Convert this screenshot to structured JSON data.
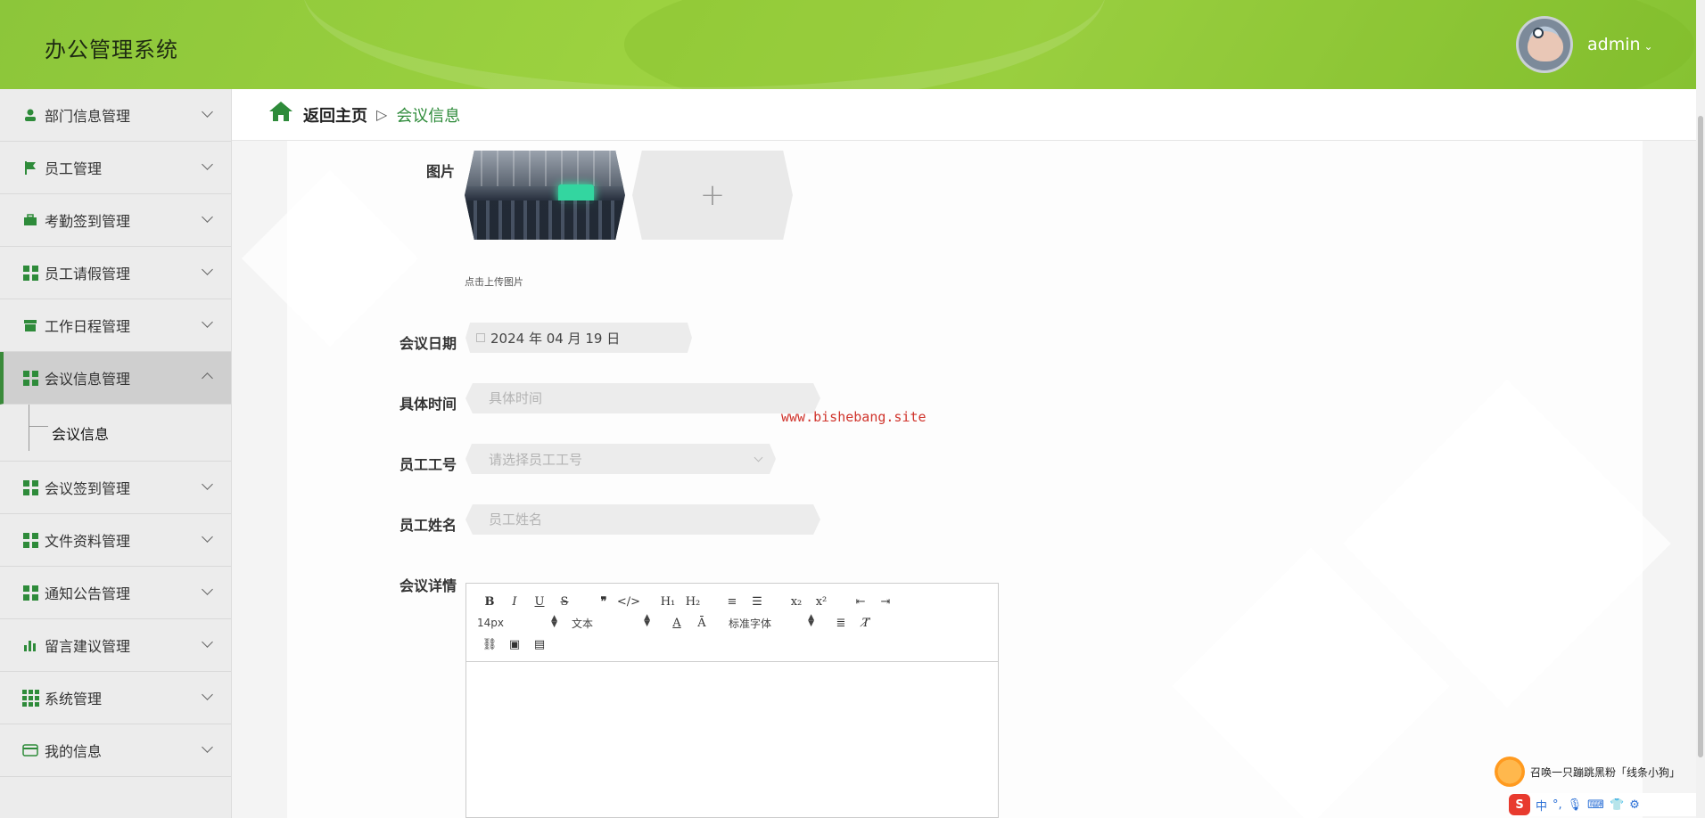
{
  "app": {
    "title": "办公管理系统",
    "user": "admin"
  },
  "breadcrumb": {
    "back": "返回主页",
    "separator": "▷",
    "current": "会议信息"
  },
  "sidebar": {
    "items": [
      {
        "label": "部门信息管理",
        "icon": "user-icon"
      },
      {
        "label": "员工管理",
        "icon": "flag-icon"
      },
      {
        "label": "考勤签到管理",
        "icon": "briefcase-icon"
      },
      {
        "label": "员工请假管理",
        "icon": "grid-icon"
      },
      {
        "label": "工作日程管理",
        "icon": "store-icon"
      },
      {
        "label": "会议信息管理",
        "icon": "grid-icon",
        "active": true,
        "sub": [
          "会议信息"
        ]
      },
      {
        "label": "会议签到管理",
        "icon": "grid-icon"
      },
      {
        "label": "文件资料管理",
        "icon": "grid-icon"
      },
      {
        "label": "通知公告管理",
        "icon": "grid-icon"
      },
      {
        "label": "留言建议管理",
        "icon": "bar-chart-icon"
      },
      {
        "label": "系统管理",
        "icon": "grid9-icon"
      },
      {
        "label": "我的信息",
        "icon": "card-icon"
      }
    ]
  },
  "form": {
    "image_label": "图片",
    "upload_hint": "点击上传图片",
    "date_label": "会议日期",
    "date_value": "2024 年 04 月 19 日",
    "time_label": "具体时间",
    "time_placeholder": "具体时间",
    "emp_no_label": "员工工号",
    "emp_no_placeholder": "请选择员工工号",
    "emp_name_label": "员工姓名",
    "emp_name_placeholder": "员工姓名",
    "detail_label": "会议详情"
  },
  "editor": {
    "font_size": "14px",
    "text_style": "文本",
    "font_family": "标准字体"
  },
  "watermark": "www.bishebang.site",
  "ime": {
    "message": "召唤一只蹦跳黑粉「线条小狗」",
    "lang": "中"
  },
  "colors": {
    "accent": "#2e8b3a",
    "header": "#9bd13f",
    "watermark": "#d0342c"
  }
}
